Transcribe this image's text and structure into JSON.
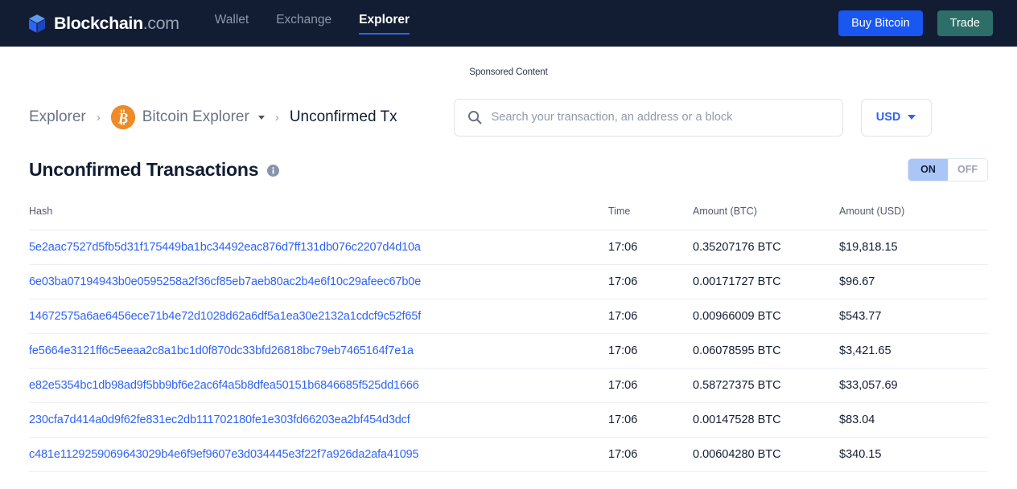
{
  "nav": {
    "brand_primary": "Blockchain",
    "brand_secondary": ".com",
    "links": [
      {
        "label": "Wallet",
        "active": false
      },
      {
        "label": "Exchange",
        "active": false
      },
      {
        "label": "Explorer",
        "active": true
      }
    ],
    "buy_button": "Buy Bitcoin",
    "trade_button": "Trade",
    "colors": {
      "background": "#121d33",
      "buy": "#1a56f0",
      "trade": "#2d6f68",
      "underline": "#2f63f6"
    }
  },
  "sponsored_label": "Sponsored Content",
  "breadcrumb": {
    "root": "Explorer",
    "separator": "›",
    "chain": "Bitcoin Explorer",
    "current": "Unconfirmed Tx",
    "chain_icon_color": "#ee8b28"
  },
  "search": {
    "placeholder": "Search your transaction, an address or a block",
    "value": ""
  },
  "currency": {
    "selected": "USD",
    "accent": "#2f63f6"
  },
  "title": {
    "text": "Unconfirmed Transactions",
    "info_tooltip": "i"
  },
  "toggle": {
    "on_label": "ON",
    "off_label": "OFF",
    "selected": "ON",
    "on_background": "#a9c6f6"
  },
  "table": {
    "columns": [
      "Hash",
      "Time",
      "Amount (BTC)",
      "Amount (USD)"
    ],
    "rows": [
      {
        "hash": "5e2aac7527d5fb5d31f175449ba1bc34492eac876d7ff131db076c2207d4d10a",
        "time": "17:06",
        "amount_btc": "0.35207176 BTC",
        "amount_usd": "$19,818.15"
      },
      {
        "hash": "6e03ba07194943b0e0595258a2f36cf85eb7aeb80ac2b4e6f10c29afeec67b0e",
        "time": "17:06",
        "amount_btc": "0.00171727 BTC",
        "amount_usd": "$96.67"
      },
      {
        "hash": "14672575a6ae6456ece71b4e72d1028d62a6df5a1ea30e2132a1cdcf9c52f65f",
        "time": "17:06",
        "amount_btc": "0.00966009 BTC",
        "amount_usd": "$543.77"
      },
      {
        "hash": "fe5664e3121ff6c5eeaa2c8a1bc1d0f870dc33bfd26818bc79eb7465164f7e1a",
        "time": "17:06",
        "amount_btc": "0.06078595 BTC",
        "amount_usd": "$3,421.65"
      },
      {
        "hash": "e82e5354bc1db98ad9f5bb9bf6e2ac6f4a5b8dfea50151b6846685f525dd1666",
        "time": "17:06",
        "amount_btc": "0.58727375 BTC",
        "amount_usd": "$33,057.69"
      },
      {
        "hash": "230cfa7d414a0d9f62fe831ec2db111702180fe1e303fd66203ea2bf454d3dcf",
        "time": "17:06",
        "amount_btc": "0.00147528 BTC",
        "amount_usd": "$83.04"
      },
      {
        "hash": "c481e1129259069643029b4e6f9ef9607e3d034445e3f22f7a926da2afa41095",
        "time": "17:06",
        "amount_btc": "0.00604280 BTC",
        "amount_usd": "$340.15"
      }
    ]
  }
}
